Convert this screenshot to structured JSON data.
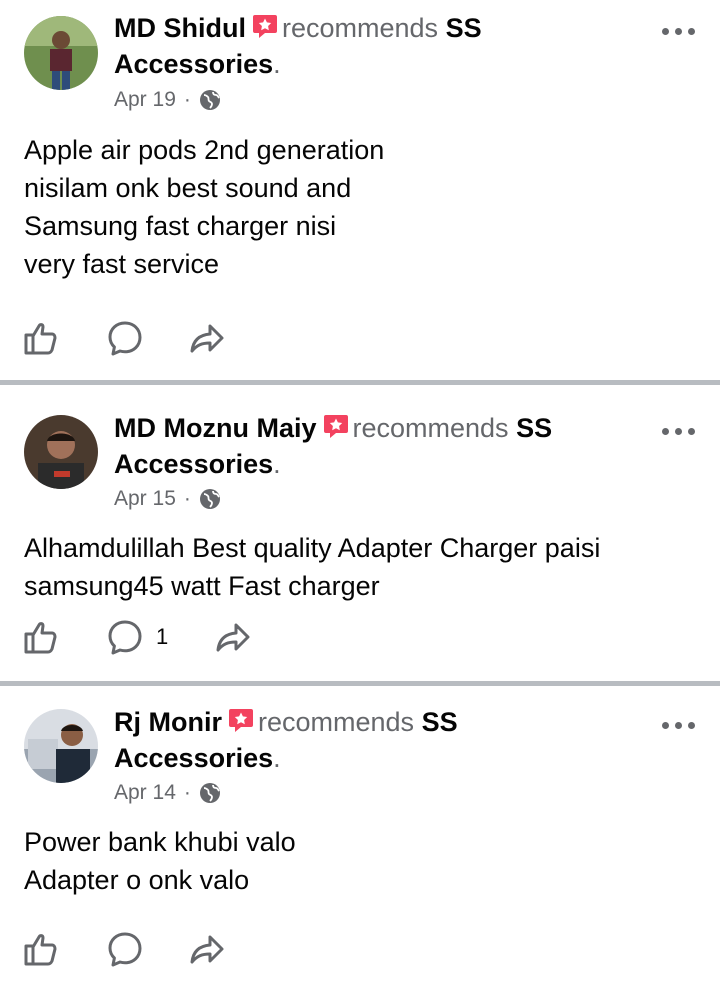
{
  "posts": [
    {
      "author": "MD Shidul",
      "action": "recommends",
      "page_name_part1": "SS",
      "page_name_part2": "Accessories",
      "date": "Apr 19",
      "dot": "·",
      "text": "Apple air pods 2nd generation\nnisilam onk best sound and\nSamsung fast charger nisi\nvery fast service",
      "comment_count": ""
    },
    {
      "author": "MD Moznu Maiy",
      "action": "recommends",
      "page_name_part1": "SS",
      "page_name_part2": "Accessories",
      "date": "Apr 15",
      "dot": "·",
      "text": "Alhamdulillah Best quality Adapter Charger paisi\nsamsung45 watt Fast charger",
      "comment_count": "1"
    },
    {
      "author": "Rj Monir",
      "action": "recommends",
      "page_name_part1": "SS",
      "page_name_part2": "Accessories",
      "date": "Apr 14",
      "dot": "·",
      "text": "Power bank khubi valo\nAdapter o onk valo",
      "comment_count": ""
    }
  ],
  "colors": {
    "badge": "#f3425f",
    "secondary_text": "#65676b",
    "separator": "#b8bcc1"
  },
  "icons": [
    "recommend-badge-icon",
    "globe-icon",
    "more-options-icon",
    "like-icon",
    "comment-icon",
    "share-icon"
  ]
}
